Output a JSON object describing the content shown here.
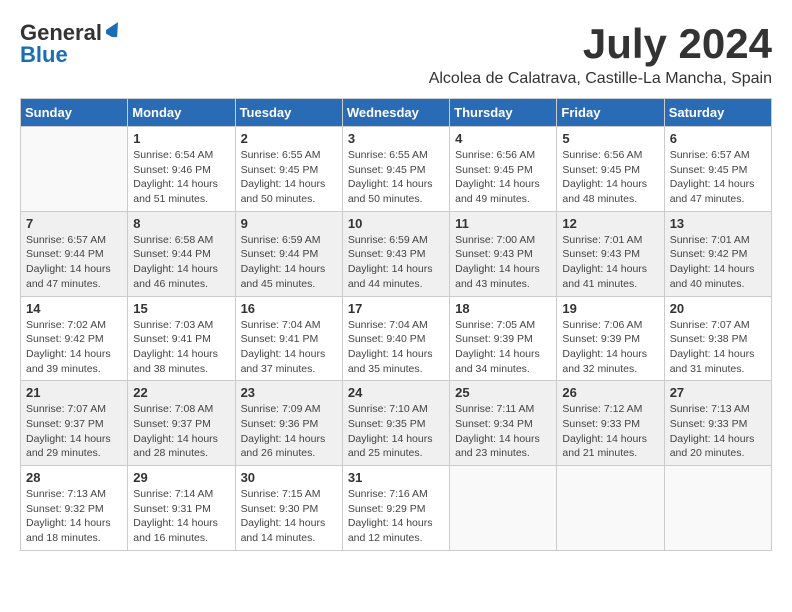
{
  "header": {
    "logo_general": "General",
    "logo_blue": "Blue",
    "title": "July 2024",
    "subtitle": "Alcolea de Calatrava, Castille-La Mancha, Spain"
  },
  "weekdays": [
    "Sunday",
    "Monday",
    "Tuesday",
    "Wednesday",
    "Thursday",
    "Friday",
    "Saturday"
  ],
  "weeks": [
    [
      {
        "day": "",
        "info": ""
      },
      {
        "day": "1",
        "info": "Sunrise: 6:54 AM\nSunset: 9:46 PM\nDaylight: 14 hours\nand 51 minutes."
      },
      {
        "day": "2",
        "info": "Sunrise: 6:55 AM\nSunset: 9:45 PM\nDaylight: 14 hours\nand 50 minutes."
      },
      {
        "day": "3",
        "info": "Sunrise: 6:55 AM\nSunset: 9:45 PM\nDaylight: 14 hours\nand 50 minutes."
      },
      {
        "day": "4",
        "info": "Sunrise: 6:56 AM\nSunset: 9:45 PM\nDaylight: 14 hours\nand 49 minutes."
      },
      {
        "day": "5",
        "info": "Sunrise: 6:56 AM\nSunset: 9:45 PM\nDaylight: 14 hours\nand 48 minutes."
      },
      {
        "day": "6",
        "info": "Sunrise: 6:57 AM\nSunset: 9:45 PM\nDaylight: 14 hours\nand 47 minutes."
      }
    ],
    [
      {
        "day": "7",
        "info": "Sunrise: 6:57 AM\nSunset: 9:44 PM\nDaylight: 14 hours\nand 47 minutes."
      },
      {
        "day": "8",
        "info": "Sunrise: 6:58 AM\nSunset: 9:44 PM\nDaylight: 14 hours\nand 46 minutes."
      },
      {
        "day": "9",
        "info": "Sunrise: 6:59 AM\nSunset: 9:44 PM\nDaylight: 14 hours\nand 45 minutes."
      },
      {
        "day": "10",
        "info": "Sunrise: 6:59 AM\nSunset: 9:43 PM\nDaylight: 14 hours\nand 44 minutes."
      },
      {
        "day": "11",
        "info": "Sunrise: 7:00 AM\nSunset: 9:43 PM\nDaylight: 14 hours\nand 43 minutes."
      },
      {
        "day": "12",
        "info": "Sunrise: 7:01 AM\nSunset: 9:43 PM\nDaylight: 14 hours\nand 41 minutes."
      },
      {
        "day": "13",
        "info": "Sunrise: 7:01 AM\nSunset: 9:42 PM\nDaylight: 14 hours\nand 40 minutes."
      }
    ],
    [
      {
        "day": "14",
        "info": "Sunrise: 7:02 AM\nSunset: 9:42 PM\nDaylight: 14 hours\nand 39 minutes."
      },
      {
        "day": "15",
        "info": "Sunrise: 7:03 AM\nSunset: 9:41 PM\nDaylight: 14 hours\nand 38 minutes."
      },
      {
        "day": "16",
        "info": "Sunrise: 7:04 AM\nSunset: 9:41 PM\nDaylight: 14 hours\nand 37 minutes."
      },
      {
        "day": "17",
        "info": "Sunrise: 7:04 AM\nSunset: 9:40 PM\nDaylight: 14 hours\nand 35 minutes."
      },
      {
        "day": "18",
        "info": "Sunrise: 7:05 AM\nSunset: 9:39 PM\nDaylight: 14 hours\nand 34 minutes."
      },
      {
        "day": "19",
        "info": "Sunrise: 7:06 AM\nSunset: 9:39 PM\nDaylight: 14 hours\nand 32 minutes."
      },
      {
        "day": "20",
        "info": "Sunrise: 7:07 AM\nSunset: 9:38 PM\nDaylight: 14 hours\nand 31 minutes."
      }
    ],
    [
      {
        "day": "21",
        "info": "Sunrise: 7:07 AM\nSunset: 9:37 PM\nDaylight: 14 hours\nand 29 minutes."
      },
      {
        "day": "22",
        "info": "Sunrise: 7:08 AM\nSunset: 9:37 PM\nDaylight: 14 hours\nand 28 minutes."
      },
      {
        "day": "23",
        "info": "Sunrise: 7:09 AM\nSunset: 9:36 PM\nDaylight: 14 hours\nand 26 minutes."
      },
      {
        "day": "24",
        "info": "Sunrise: 7:10 AM\nSunset: 9:35 PM\nDaylight: 14 hours\nand 25 minutes."
      },
      {
        "day": "25",
        "info": "Sunrise: 7:11 AM\nSunset: 9:34 PM\nDaylight: 14 hours\nand 23 minutes."
      },
      {
        "day": "26",
        "info": "Sunrise: 7:12 AM\nSunset: 9:33 PM\nDaylight: 14 hours\nand 21 minutes."
      },
      {
        "day": "27",
        "info": "Sunrise: 7:13 AM\nSunset: 9:33 PM\nDaylight: 14 hours\nand 20 minutes."
      }
    ],
    [
      {
        "day": "28",
        "info": "Sunrise: 7:13 AM\nSunset: 9:32 PM\nDaylight: 14 hours\nand 18 minutes."
      },
      {
        "day": "29",
        "info": "Sunrise: 7:14 AM\nSunset: 9:31 PM\nDaylight: 14 hours\nand 16 minutes."
      },
      {
        "day": "30",
        "info": "Sunrise: 7:15 AM\nSunset: 9:30 PM\nDaylight: 14 hours\nand 14 minutes."
      },
      {
        "day": "31",
        "info": "Sunrise: 7:16 AM\nSunset: 9:29 PM\nDaylight: 14 hours\nand 12 minutes."
      },
      {
        "day": "",
        "info": ""
      },
      {
        "day": "",
        "info": ""
      },
      {
        "day": "",
        "info": ""
      }
    ]
  ]
}
